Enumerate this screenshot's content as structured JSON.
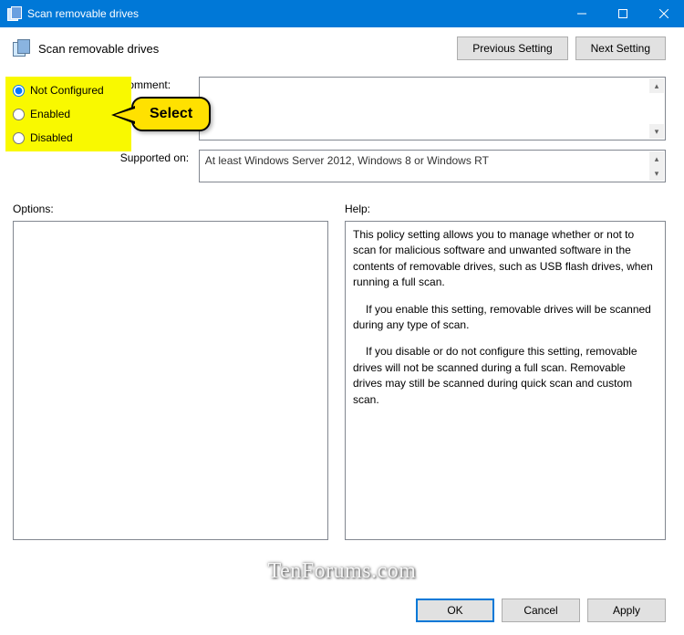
{
  "titlebar": {
    "title": "Scan removable drives"
  },
  "header": {
    "title": "Scan removable drives",
    "prev_label": "Previous Setting",
    "next_label": "Next Setting"
  },
  "radios": {
    "not_configured": "Not Configured",
    "enabled": "Enabled",
    "disabled": "Disabled",
    "selected": "not_configured"
  },
  "callout": {
    "text": "Select"
  },
  "fields": {
    "comment_label": "Comment:",
    "supported_label": "Supported on:",
    "supported_value": "At least Windows Server 2012, Windows 8 or Windows RT"
  },
  "panes": {
    "options_label": "Options:",
    "help_label": "Help:",
    "help_text": {
      "p1": "This policy setting allows you to manage whether or not to scan for malicious software and unwanted software in the contents of removable drives, such as USB flash drives, when running a full scan.",
      "p2": "If you enable this setting, removable drives will be scanned during any type of scan.",
      "p3": "If you disable or do not configure this setting, removable drives will not be scanned during a full scan. Removable drives may still be scanned during quick scan and custom scan."
    }
  },
  "footer": {
    "ok": "OK",
    "cancel": "Cancel",
    "apply": "Apply"
  },
  "watermark": "TenForums.com"
}
